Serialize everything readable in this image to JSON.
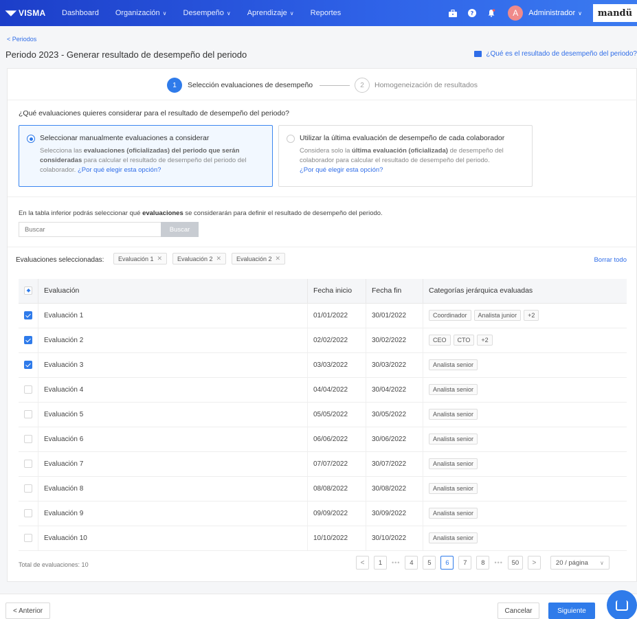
{
  "nav": {
    "logo": "VISMA",
    "items": [
      {
        "label": "Dashboard",
        "dropdown": false
      },
      {
        "label": "Organización",
        "dropdown": true
      },
      {
        "label": "Desempeño",
        "dropdown": true
      },
      {
        "label": "Aprendizaje",
        "dropdown": true
      },
      {
        "label": "Reportes",
        "dropdown": false
      }
    ],
    "icons": [
      "briefcase-icon",
      "help-icon",
      "bell-icon"
    ],
    "avatar_initial": "A",
    "user": "Administrador",
    "brand": "mandü"
  },
  "breadcrumb": {
    "back": "< Periodos"
  },
  "page": {
    "title": "Periodo 2023 - Generar resultado de desempeño del periodo",
    "help_link": "¿Qué es el resultado de desempeño del periodo?"
  },
  "steps": [
    {
      "num": "1",
      "label": "Selección evaluaciones de desempeño"
    },
    {
      "num": "2",
      "label": "Homogeneización de resultados"
    }
  ],
  "question": "¿Qué evaluaciones quieres considerar para el resultado de desempeño del periodo?",
  "options": {
    "manual": {
      "title": "Seleccionar manualmente evaluaciones a considerar",
      "d1": "Selecciona las ",
      "d2": "evaluaciones (oficializadas) del periodo que serán consideradas",
      "d3": " para calcular el resultado de desempeño del periodo del colaborador. ",
      "link": "¿Por qué elegir esta opción?"
    },
    "last": {
      "title": "Utilizar la última evaluación de desempeño de cada colaborador",
      "d1": "Considera solo la ",
      "d2": "última evaluación (oficializada)",
      "d3": " de desempeño del colaborador para calcular el resultado de desempeño del periodo.",
      "link": "¿Por qué elegir esta opción?"
    }
  },
  "info": {
    "a": "En la tabla inferior podrás seleccionar qué ",
    "b": "evaluaciones",
    "c": " se considerarán para definir el resultado de desempeño del periodo."
  },
  "search": {
    "placeholder": "Buscar",
    "button": "Buscar"
  },
  "selected": {
    "label": "Evaluaciones seleccionadas:",
    "chips": [
      "Evaluación 1",
      "Evaluación 2",
      "Evaluación 2"
    ],
    "clear": "Borrar todo"
  },
  "table": {
    "headers": [
      "Evaluación",
      "Fecha inicio",
      "Fecha fin",
      "Categorías jerárquica evaluadas"
    ],
    "rows": [
      {
        "name": "Evaluación 1",
        "start": "01/01/2022",
        "end": "30/01/2022",
        "tags": [
          "Coordinador",
          "Analista junior",
          "+2"
        ],
        "checked": true
      },
      {
        "name": "Evaluación 2",
        "start": "02/02/2022",
        "end": "30/02/2022",
        "tags": [
          "CEO",
          "CTO",
          "+2"
        ],
        "checked": true
      },
      {
        "name": "Evaluación 3",
        "start": "03/03/2022",
        "end": "30/03/2022",
        "tags": [
          "Analista senior"
        ],
        "checked": true
      },
      {
        "name": "Evaluación 4",
        "start": "04/04/2022",
        "end": "30/04/2022",
        "tags": [
          "Analista senior"
        ],
        "checked": false
      },
      {
        "name": "Evaluación 5",
        "start": "05/05/2022",
        "end": "30/05/2022",
        "tags": [
          "Analista senior"
        ],
        "checked": false
      },
      {
        "name": "Evaluación 6",
        "start": "06/06/2022",
        "end": "30/06/2022",
        "tags": [
          "Analista senior"
        ],
        "checked": false
      },
      {
        "name": "Evaluación 7",
        "start": "07/07/2022",
        "end": "30/07/2022",
        "tags": [
          "Analista senior"
        ],
        "checked": false
      },
      {
        "name": "Evaluación 8",
        "start": "08/08/2022",
        "end": "30/08/2022",
        "tags": [
          "Analista senior"
        ],
        "checked": false
      },
      {
        "name": "Evaluación 9",
        "start": "09/09/2022",
        "end": "30/09/2022",
        "tags": [
          "Analista senior"
        ],
        "checked": false
      },
      {
        "name": "Evaluación 10",
        "start": "10/10/2022",
        "end": "30/10/2022",
        "tags": [
          "Analista senior"
        ],
        "checked": false
      }
    ]
  },
  "pagination": {
    "total": "Total de evaluaciones: 10",
    "prev": "<",
    "next": ">",
    "ellipsis": "•••",
    "pages": [
      "1",
      "4",
      "5",
      "6",
      "7",
      "8",
      "50"
    ],
    "current": "6",
    "per_page": "20 / página"
  },
  "footer": {
    "prev": "< Anterior",
    "cancel": "Cancelar",
    "next": "Siguiente"
  },
  "colors": {
    "primary": "#2f7bea",
    "nav_start": "#1c3ec9",
    "nav_end": "#3b7bf0",
    "avatar": "#f08a8a"
  }
}
